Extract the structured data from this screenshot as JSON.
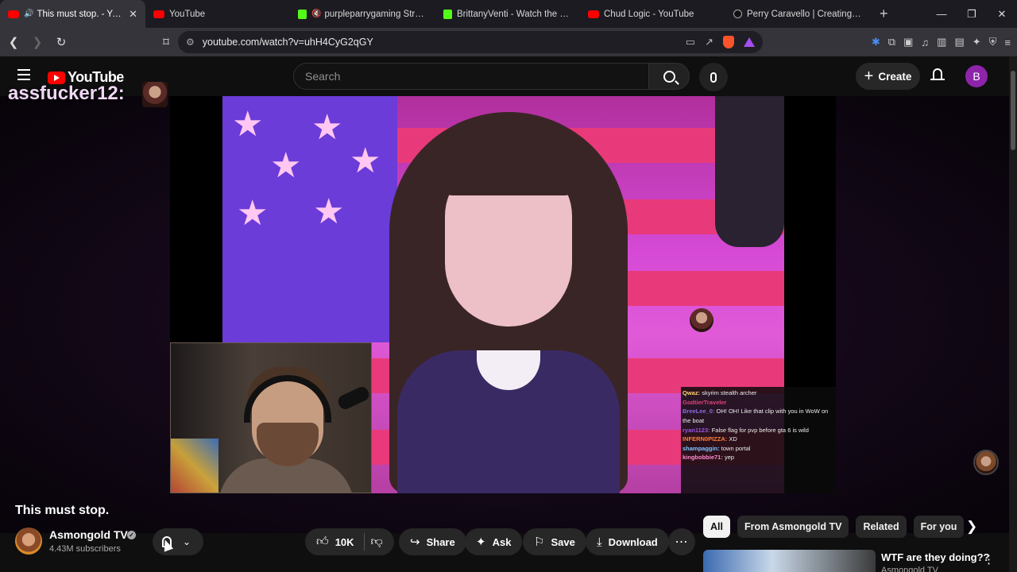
{
  "browser": {
    "tabs": [
      {
        "title": "This must stop. - YouTube",
        "active": true,
        "icon": "youtube-icon"
      },
      {
        "title": "YouTube",
        "active": false,
        "icon": "youtube-icon"
      },
      {
        "title": "purpleparrygaming Stream -",
        "active": false,
        "icon": "kick-icon"
      },
      {
        "title": "BrittanyVenti - Watch the VOD o",
        "active": false,
        "icon": "kick-icon"
      },
      {
        "title": "Chud Logic - YouTube",
        "active": false,
        "icon": "youtube-icon"
      },
      {
        "title": "Perry Caravello | Creating Come",
        "active": false,
        "icon": "tiktok-icon"
      }
    ],
    "url": "youtube.com/watch?v=uhH4CyG2qGY"
  },
  "youtube": {
    "logo_text": "YouTube",
    "search_placeholder": "Search",
    "create_label": "Create",
    "avatar_letter": "B"
  },
  "video": {
    "overlay_username": "assfucker12:",
    "chat": [
      {
        "user": "Qwaz",
        "msg": "skyrim stealth archer",
        "color": "#ffd36e"
      },
      {
        "user": "GodtierTraveler",
        "msg": "",
        "color": "#e0407a"
      },
      {
        "user": "BreeLee_0",
        "msg": "OH! OH! Like that clip with you in WoW on the boat",
        "color": "#8a6de0"
      },
      {
        "user": "ryan1123",
        "msg": "False flag for pvp before gta 6 is wild",
        "color": "#9b57e6"
      },
      {
        "user": "INFERN0PIZZA",
        "msg": "XD",
        "color": "#ff7e3a"
      },
      {
        "user": "shampaggin",
        "msg": "town portal",
        "color": "#7ec3ff"
      },
      {
        "user": "kingbobbie71",
        "msg": "yep",
        "color": "#ff8bd0"
      }
    ]
  },
  "meta": {
    "title": "This must stop.",
    "channel_name": "Asmongold TV",
    "subscribers": "4.43M subscribers",
    "like_count": "10K",
    "share_label": "Share",
    "ask_label": "Ask",
    "save_label": "Save",
    "download_label": "Download"
  },
  "sidebar": {
    "chips": [
      {
        "label": "All",
        "selected": true
      },
      {
        "label": "From Asmongold TV",
        "selected": false
      },
      {
        "label": "Related",
        "selected": false
      },
      {
        "label": "For you",
        "selected": false
      }
    ],
    "rec": {
      "title": "WTF are they doing??",
      "channel": "Asmongold TV"
    }
  }
}
